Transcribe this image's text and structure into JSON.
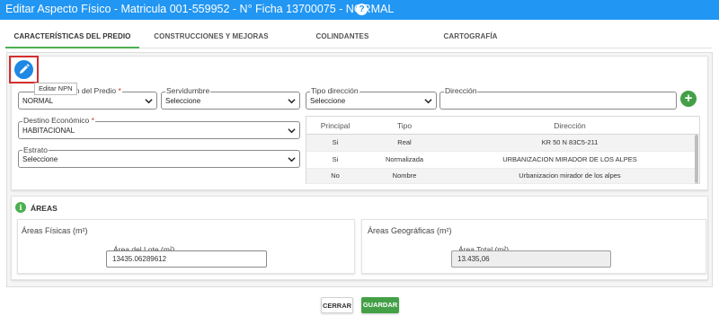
{
  "dialog": {
    "title": "Editar Aspecto Físico - Matricula 001-559952 - N° Ficha 13700075 - NORMAL",
    "help_icon": "question-circle-icon"
  },
  "tabs": [
    {
      "label": "CARACTERÍSTICAS DEL PREDIO",
      "active": true
    },
    {
      "label": "CONSTRUCCIONES Y MEJORAS",
      "active": false
    },
    {
      "label": "COLINDANTES",
      "active": false
    },
    {
      "label": "CARTOGRAFÍA",
      "active": false
    }
  ],
  "edit": {
    "icon": "pencil-icon",
    "tooltip": "Editar NPN"
  },
  "form": {
    "condicion": {
      "label_visible": "ón del Predio",
      "value": "NORMAL"
    },
    "servidumbre": {
      "label": "Servidumbre",
      "value": "Seleccione"
    },
    "tipo_direccion": {
      "label": "Tipo dirección",
      "value": "Seleccione"
    },
    "direccion": {
      "label": "Dirección",
      "value": ""
    },
    "destino": {
      "label": "Destino Económico",
      "value": "HABITACIONAL"
    },
    "estrato": {
      "label": "Estrato",
      "value": "Seleccione"
    },
    "required_mark": "*"
  },
  "direcciones": {
    "headers": [
      "Principal",
      "Tipo",
      "Dirección"
    ],
    "rows": [
      [
        "Si",
        "Real",
        "KR 50 N 83C5-211"
      ],
      [
        "Si",
        "Normalizada",
        "URBANIZACION MIRADOR DE LOS ALPES"
      ],
      [
        "No",
        "Nombre",
        "Urbanizacion mirador de los alpes"
      ]
    ]
  },
  "areas": {
    "section_title": "ÁREAS",
    "fisicas": {
      "title": "Áreas Físicas (m²)",
      "field_label": "Área del Lote (m²)",
      "value": "13435.06289612"
    },
    "geograficas": {
      "title": "Áreas Geográficas (m²)",
      "field_label": "Área Total (m²)",
      "value": "13.435,06"
    }
  },
  "footer": {
    "close_label": "CERRAR",
    "save_label": "GUARDAR"
  },
  "colors": {
    "primary": "#2196f3",
    "success": "#43a047",
    "highlight": "#d32f2f"
  }
}
